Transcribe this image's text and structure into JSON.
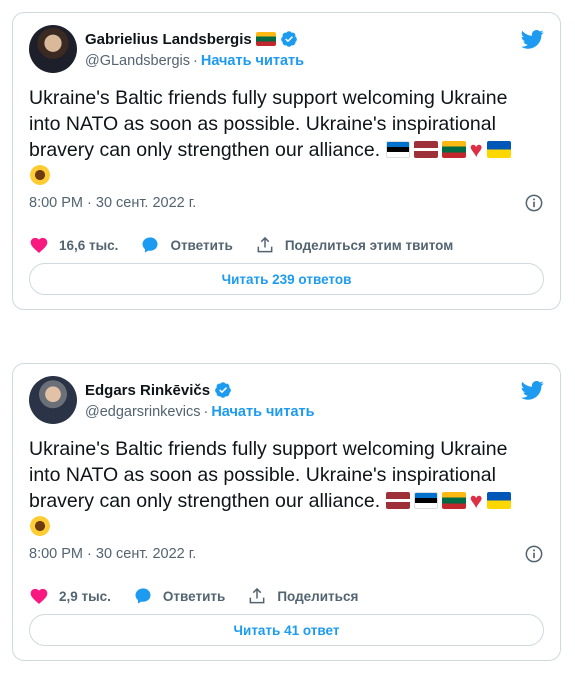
{
  "tweets": [
    {
      "author": {
        "name": "Gabrielius Landsbergis",
        "handle": "@GLandsbergis",
        "name_flag": "flag-lithuania"
      },
      "follow_label": "Начать читать",
      "text": "Ukraine's Baltic friends fully support welcoming Ukraine into NATO as soon as possible. Ukraine's inspirational bravery can only strengthen our alliance.",
      "emojis": [
        "flag-estonia",
        "flag-latvia",
        "flag-lithuania",
        "red-heart",
        "flag-ukraine",
        "sunflower"
      ],
      "timestamp": "8:00 PM · 30 сент. 2022 г.",
      "likes": "16,6 тыс.",
      "reply_label": "Ответить",
      "share_label": "Поделиться этим твитом",
      "read_replies_label": "Читать 239 ответов"
    },
    {
      "author": {
        "name": "Edgars Rinkēvičs",
        "handle": "@edgarsrinkevics"
      },
      "follow_label": "Начать читать",
      "text": "Ukraine's Baltic friends fully support welcoming Ukraine into NATO as soon as possible. Ukraine's inspirational bravery can only strengthen our alliance.",
      "emojis": [
        "flag-latvia",
        "flag-estonia",
        "flag-lithuania",
        "red-heart",
        "flag-ukraine",
        "sunflower"
      ],
      "timestamp": "8:00 PM · 30 сент. 2022 г.",
      "likes": "2,9 тыс.",
      "reply_label": "Ответить",
      "share_label": "Поделиться",
      "read_replies_label": "Читать 41 ответ"
    }
  ],
  "colors": {
    "accent": "#1d9bf0",
    "heart": "#f91880",
    "text": "#0f1419",
    "muted": "#536471",
    "border": "#cfd9de"
  }
}
